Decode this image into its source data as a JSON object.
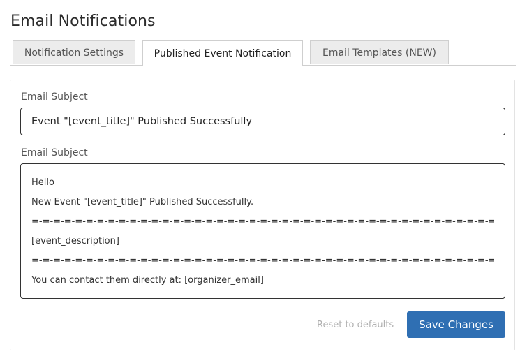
{
  "page": {
    "title": "Email Notifications"
  },
  "tabs": [
    {
      "label": "Notification Settings",
      "active": false
    },
    {
      "label": "Published Event Notification",
      "active": true
    },
    {
      "label": "Email Templates (NEW)",
      "active": false
    }
  ],
  "form": {
    "subject_label": "Email Subject",
    "subject_value": "Event \"[event_title]\" Published Successfully",
    "body_label": "Email Subject",
    "body_lines": [
      "Hello",
      "New Event \"[event_title]\" Published Successfully.",
      "=-=-=-=-=-=-=-=-=-=-=-=-=-=-=-=-=-=-=-=-=-=-=-=-=-=-=-=-=-=-=-=-=-=-=-=-=-=-=-=-=-=-=-=-=-=-=-=-=-=-=-=",
      "[event_description]",
      "=-=-=-=-=-=-=-=-=-=-=-=-=-=-=-=-=-=-=-=-=-=-=-=-=-=-=-=-=-=-=-=-=-=-=-=-=-=-=-=-=-=-=-=-=-=-=-=-=-=-=-=",
      "You can contact them directly at: [organizer_email]"
    ]
  },
  "actions": {
    "reset_label": "Reset to defaults",
    "save_label": "Save Changes"
  },
  "colors": {
    "primary_button": "#2f6fb3",
    "active_tab_bg": "#ffffff",
    "inactive_tab_bg": "#ececec"
  }
}
